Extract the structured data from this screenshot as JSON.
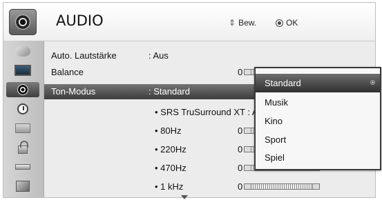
{
  "header": {
    "title": "AUDIO",
    "move_label": "Bew.",
    "ok_label": "OK"
  },
  "sidebar": {
    "icons": [
      "satellite-icon",
      "tv-icon",
      "audio-icon",
      "clock-icon",
      "case-icon",
      "lock-icon",
      "usb-icon",
      "photo-icon"
    ],
    "active": "audio-icon"
  },
  "menu": {
    "rows": [
      {
        "label": "Auto. Lautstärke",
        "value": ": Aus"
      },
      {
        "label": "Balance",
        "number": "0"
      },
      {
        "label": "Ton-Modus",
        "value": ": Standard"
      },
      {
        "sub": "• SRS TruSurround XT : Aus"
      },
      {
        "sub": "• 80Hz",
        "number": "0"
      },
      {
        "sub": "• 220Hz",
        "number": "0"
      },
      {
        "sub": "• 470Hz",
        "number": "0"
      },
      {
        "sub": "• 1 kHz",
        "number": "0"
      }
    ]
  },
  "popup": {
    "options": [
      "Standard",
      "Musik",
      "Kino",
      "Sport",
      "Spiel"
    ],
    "selected": "Standard"
  },
  "colors": {
    "highlight": "#4a4a4a",
    "background": "#ececec"
  }
}
